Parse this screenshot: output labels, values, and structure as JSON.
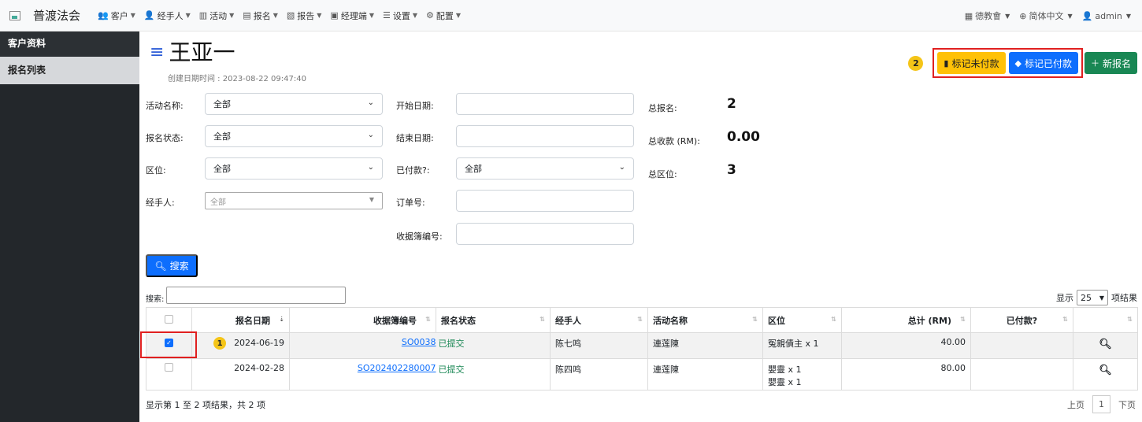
{
  "brand": {
    "name": "普渡法会"
  },
  "nav": {
    "items": [
      {
        "icon": "users-icon",
        "label": "客户"
      },
      {
        "icon": "user-tie-icon",
        "label": "经手人"
      },
      {
        "icon": "map-icon",
        "label": "活动"
      },
      {
        "icon": "list-icon",
        "label": "报名"
      },
      {
        "icon": "file-icon",
        "label": "报告"
      },
      {
        "icon": "briefcase-icon",
        "label": "经理端"
      },
      {
        "icon": "sliders-icon",
        "label": "设置"
      },
      {
        "icon": "gear-icon",
        "label": "配置"
      }
    ],
    "right": {
      "org": "德教會",
      "lang": "简体中文",
      "user": "admin"
    }
  },
  "sidebar": {
    "items": [
      "客户资料",
      "报名列表"
    ]
  },
  "page": {
    "title": "王亚一",
    "created": "创建日期时间 : 2023-08-22 09:47:40"
  },
  "actions": {
    "badge": "2",
    "unpaid": "标记未付款",
    "paid": "标记已付款",
    "new": "新报名"
  },
  "filters": {
    "activity": {
      "label": "活动名称:",
      "value": "全部"
    },
    "status": {
      "label": "报名状态:",
      "value": "全部"
    },
    "zone": {
      "label": "区位:",
      "value": "全部"
    },
    "agent": {
      "label": "经手人:",
      "value": "全部"
    },
    "start": {
      "label": "开始日期:"
    },
    "end": {
      "label": "结束日期:"
    },
    "paid": {
      "label": "已付款?:",
      "value": "全部"
    },
    "order": {
      "label": "订单号:"
    },
    "receipt": {
      "label": "收据簿编号:"
    }
  },
  "stats": {
    "total_label": "总报名:",
    "total": "2",
    "income_label": "总收款 (RM):",
    "income": "0.00",
    "zones_label": "总区位:",
    "zones": "3"
  },
  "search": {
    "button": "搜索",
    "label": "搜索:"
  },
  "length": {
    "prefix": "显示",
    "value": "25",
    "suffix": "项结果"
  },
  "table": {
    "headers": [
      "报名日期",
      "收据簿编号",
      "报名状态",
      "经手人",
      "活动名称",
      "区位",
      "总计 (RM)",
      "已付款?"
    ],
    "rows": [
      {
        "badge": "1",
        "date": "2024-06-19",
        "receipt": "SO0038",
        "status": "已提交",
        "agent": "陈七鸣",
        "activity": "連莲陳",
        "zone": [
          "冤親債主 x 1"
        ],
        "total": "40.00",
        "paid": ""
      },
      {
        "date": "2024-02-28",
        "receipt": "SO202402280007",
        "status": "已提交",
        "agent": "陈四鸣",
        "activity": "連莲陳",
        "zone": [
          "嬰靈 x 1",
          "嬰靈 x 1"
        ],
        "total": "80.00",
        "paid": ""
      }
    ]
  },
  "footer": {
    "info": "显示第 1 至 2 项结果，共 2 项",
    "prev": "上页",
    "page": "1",
    "next": "下页"
  }
}
